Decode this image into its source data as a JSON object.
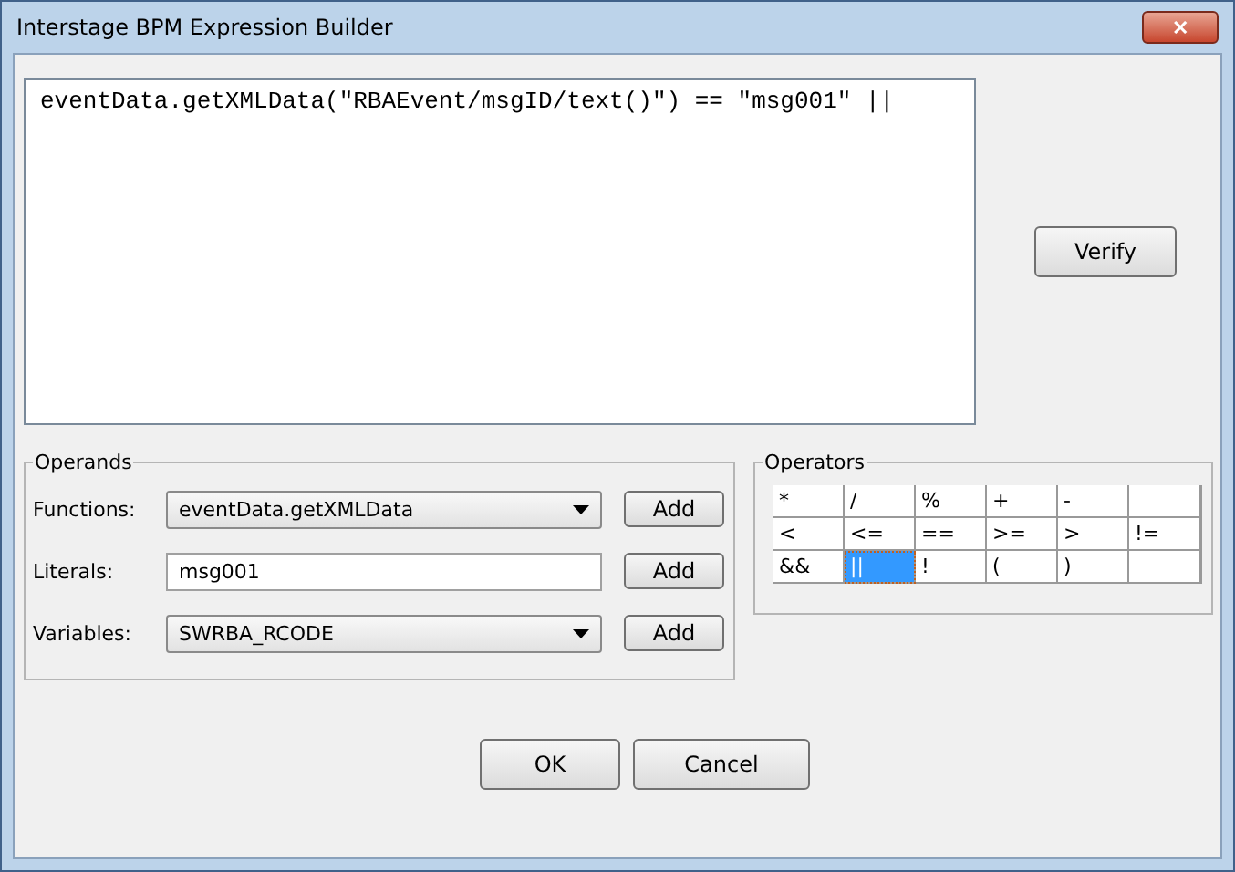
{
  "window": {
    "title": "Interstage BPM Expression Builder",
    "close": "✕"
  },
  "expression": {
    "value": "eventData.getXMLData(\"RBAEvent/msgID/text()\") == \"msg001\" ||"
  },
  "verify_button": "Verify",
  "operands": {
    "title": "Operands",
    "rows": [
      {
        "kind": "dropdown",
        "label": "Functions:",
        "value": "eventData.getXMLData",
        "button": "Add"
      },
      {
        "kind": "text",
        "label": "Literals:",
        "value": "msg001",
        "button": "Add"
      },
      {
        "kind": "dropdown",
        "label": "Variables:",
        "value": "SWRBA_RCODE",
        "button": "Add"
      }
    ]
  },
  "operators": {
    "title": "Operators",
    "rows": [
      [
        {
          "label": "*",
          "selected": false
        },
        {
          "label": "/",
          "selected": false
        },
        {
          "label": "%",
          "selected": false
        },
        {
          "label": "+",
          "selected": false
        },
        {
          "label": "-",
          "selected": false
        }
      ],
      [
        {
          "label": "<",
          "selected": false
        },
        {
          "label": "<=",
          "selected": false
        },
        {
          "label": "==",
          "selected": false
        },
        {
          "label": ">=",
          "selected": false
        },
        {
          "label": ">",
          "selected": false
        },
        {
          "label": "!=",
          "selected": false
        }
      ],
      [
        {
          "label": "&&",
          "selected": false
        },
        {
          "label": "||",
          "selected": true
        },
        {
          "label": "!",
          "selected": false
        },
        {
          "label": "(",
          "selected": false
        },
        {
          "label": ")",
          "selected": false
        }
      ]
    ]
  },
  "buttons": [
    "OK",
    "Cancel"
  ]
}
